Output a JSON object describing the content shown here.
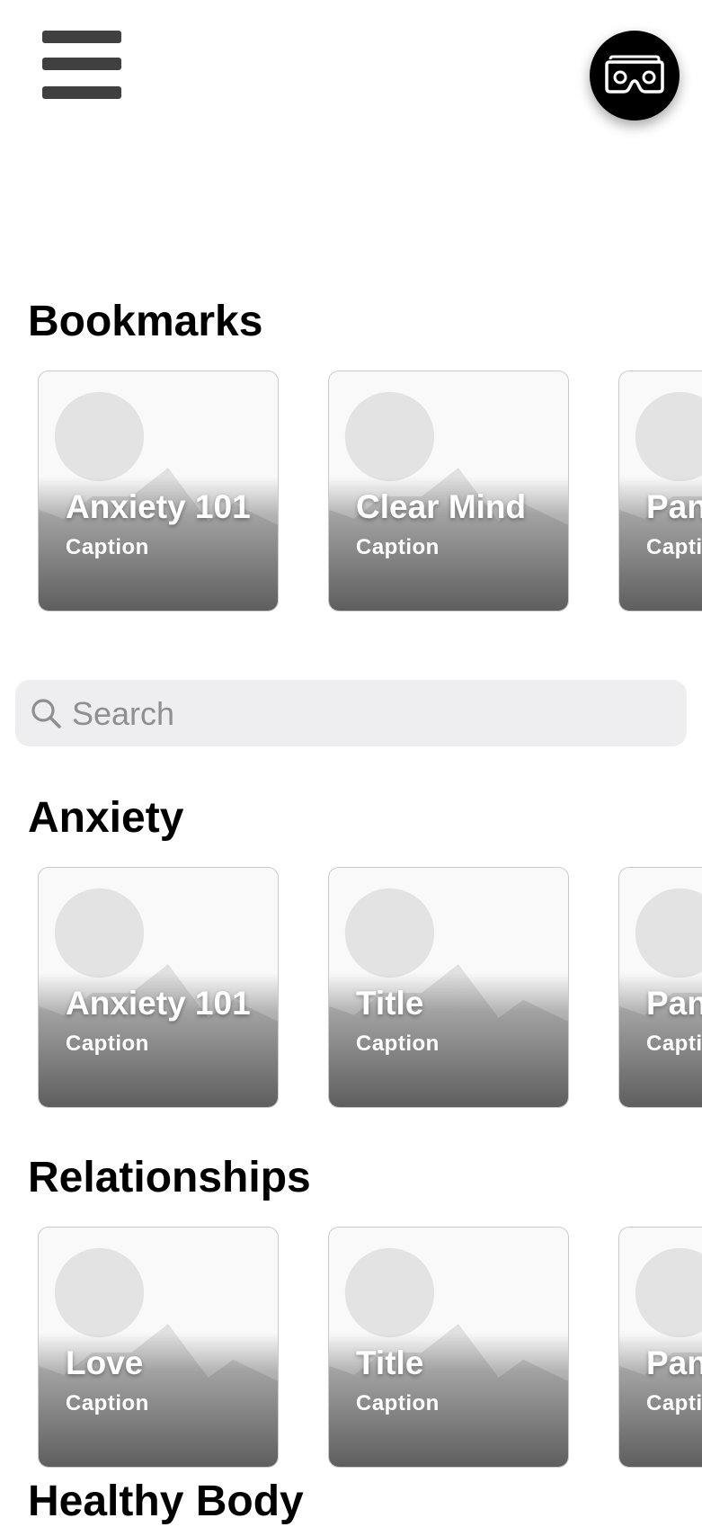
{
  "header": {
    "menu_icon": "hamburger-menu-icon",
    "vr_icon": "vr-headset-icon"
  },
  "sections": {
    "bookmarks": {
      "title": "Bookmarks",
      "cards": [
        {
          "title": "Anxiety 101",
          "caption": "Caption"
        },
        {
          "title": "Clear Mind",
          "caption": "Caption"
        },
        {
          "title": "Panic Attack",
          "caption": "Caption"
        }
      ]
    },
    "anxiety": {
      "title": "Anxiety",
      "cards": [
        {
          "title": "Anxiety 101",
          "caption": "Caption"
        },
        {
          "title": "Title",
          "caption": "Caption"
        },
        {
          "title": "Panic Attack",
          "caption": "Caption"
        }
      ]
    },
    "relationships": {
      "title": "Relationships",
      "cards": [
        {
          "title": "Love",
          "caption": "Caption"
        },
        {
          "title": "Title",
          "caption": "Caption"
        },
        {
          "title": "Panic Attack",
          "caption": "Caption"
        }
      ]
    },
    "healthy_body": {
      "title": "Healthy Body"
    }
  },
  "search": {
    "placeholder": "Search",
    "icon": "search-icon"
  }
}
